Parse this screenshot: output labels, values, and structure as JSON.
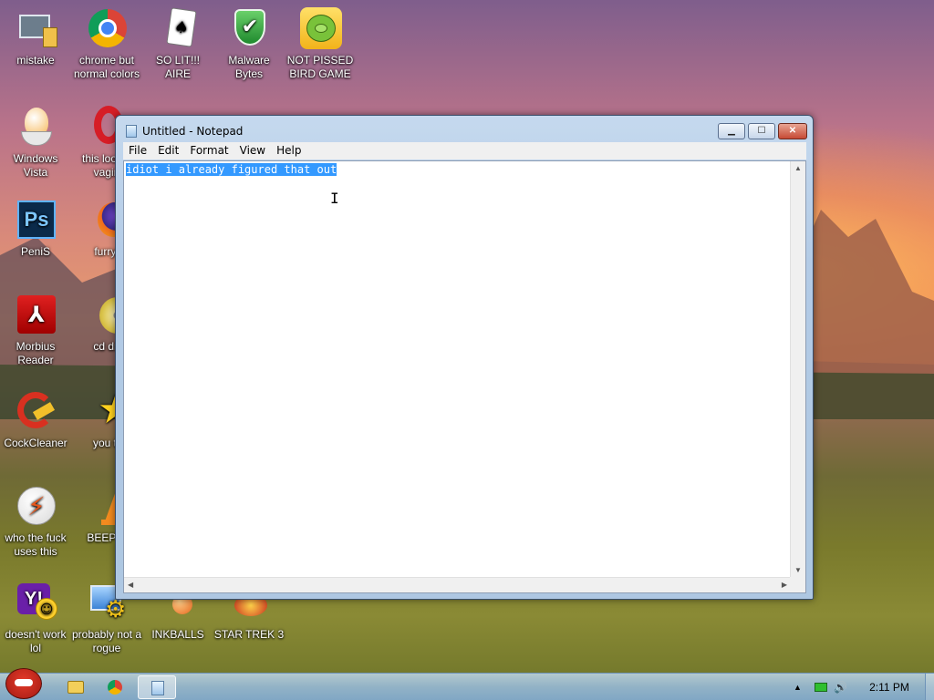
{
  "desktop": {
    "icons": [
      {
        "label": "mistake"
      },
      {
        "label": "chrome but normal colors"
      },
      {
        "label": "SO LIT!!! AIRE"
      },
      {
        "label": "Malware Bytes"
      },
      {
        "label": "NOT PISSED BIRD GAME"
      },
      {
        "label": "Windows Vista"
      },
      {
        "label": "this look a vagin"
      },
      {
        "label": "PeniS"
      },
      {
        "label": "furryf"
      },
      {
        "label": "Morbius Reader"
      },
      {
        "label": "cd dri"
      },
      {
        "label": "CockCleaner"
      },
      {
        "label": "you tr"
      },
      {
        "label": "who the fuck uses this"
      },
      {
        "label": "BEEP B"
      },
      {
        "label": "doesn't work lol"
      },
      {
        "label": "probably not a rogue"
      },
      {
        "label": "INKBALLS"
      },
      {
        "label": "STAR TREK 3"
      }
    ]
  },
  "notepad": {
    "title": "Untitled - Notepad",
    "menu": [
      "File",
      "Edit",
      "Format",
      "View",
      "Help"
    ],
    "content": "idiot i already figured that out"
  },
  "taskbar": {
    "clock": "2:11 PM"
  },
  "colors": {
    "selection": "#3399ff",
    "taskbar": "#9fbfdc"
  }
}
